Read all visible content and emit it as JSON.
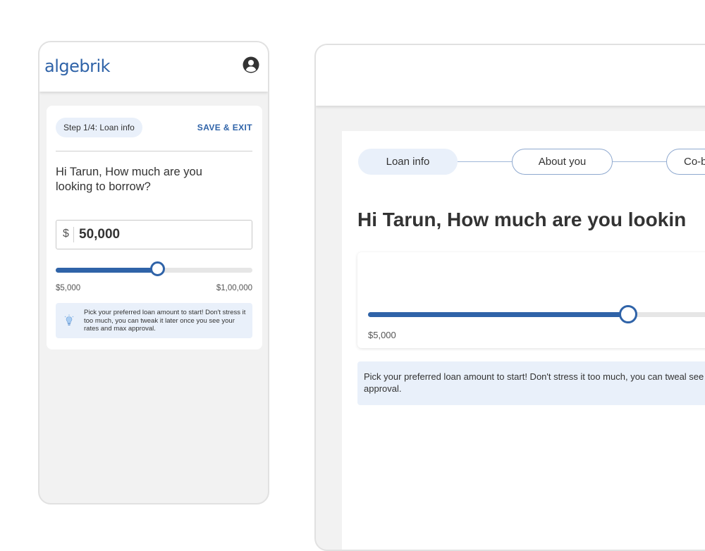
{
  "mobile": {
    "logo": "algebrik",
    "profile_icon": "user-circle-icon",
    "step_pill": "Step 1/4: Loan info",
    "save_exit": "SAVE & EXIT",
    "question": "Hi Tarun, How much are you looking to borrow?",
    "amount": {
      "currency": "$",
      "value": "50,000"
    },
    "slider": {
      "min_label": "$5,000",
      "max_label": "$1,00,000",
      "fill_fraction": 0.525
    },
    "tip": {
      "icon": "lightbulb-icon",
      "text": "Pick your preferred loan amount to start! Don't stress it too much, you can tweak it later once you see your rates and max approval."
    }
  },
  "desktop": {
    "steps": [
      {
        "label": "Loan info",
        "active": true
      },
      {
        "label": "About you",
        "active": false
      },
      {
        "label": "Co-b",
        "active": false
      }
    ],
    "question": "Hi Tarun, How much are you lookin",
    "slider": {
      "min_label": "$5,000",
      "fill_fraction": 0.66
    },
    "tip": {
      "text": "Pick your preferred loan amount to start! Don't stress it too much, you can tweal see your rates and max approval."
    }
  },
  "colors": {
    "brand": "#2f63a8",
    "tip_background": "#e9f0fa",
    "page_background": "#f2f2f2"
  }
}
